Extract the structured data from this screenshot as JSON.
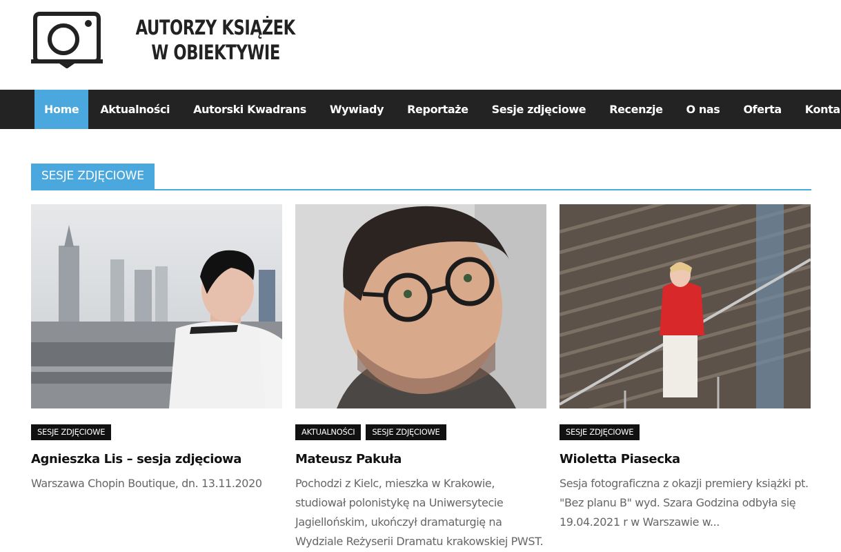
{
  "site": {
    "logo_line1": "AUTORZY KSIĄŻEK",
    "logo_line2": "W OBIEKTYWIE",
    "logo_icon": "camera-book-icon"
  },
  "nav": {
    "items": [
      {
        "label": "Home",
        "active": true
      },
      {
        "label": "Aktualności"
      },
      {
        "label": "Autorski Kwadrans"
      },
      {
        "label": "Wywiady"
      },
      {
        "label": "Reportaże"
      },
      {
        "label": "Sesje zdjęciowe"
      },
      {
        "label": "Recenzje"
      },
      {
        "label": "O nas"
      },
      {
        "label": "Oferta"
      },
      {
        "label": "Kontakt"
      }
    ]
  },
  "section": {
    "title": "SESJE ZDJĘCIOWE"
  },
  "posts": [
    {
      "categories": [
        "SESJE ZDJĘCIOWE"
      ],
      "title": "Agnieszka Lis – sesja zdjęciowa",
      "excerpt": "Warszawa Chopin Boutique, dn. 13.11.2020"
    },
    {
      "categories": [
        "AKTUALNOŚCI",
        "SESJE ZDJĘCIOWE"
      ],
      "title": "Mateusz Pakuła",
      "excerpt": "Pochodzi z Kielc, mieszka w Krakowie, studiował polonistykę na Uniwersytecie Jagiellońskim, ukończył dramaturgię na Wydziale Reżyserii Dramatu krakowskiej PWST."
    },
    {
      "categories": [
        "SESJE ZDJĘCIOWE"
      ],
      "title": "Wioletta Piasecka",
      "excerpt": "Sesja fotograficzna z okazji premiery książki pt. \"Bez planu B\" wyd. Szara Godzina odbyła się 19.04.2021 r w Warszawie w..."
    }
  ],
  "colors": {
    "accent": "#4aa8df",
    "nav_bg": "#232323",
    "category_bg": "#111111"
  }
}
